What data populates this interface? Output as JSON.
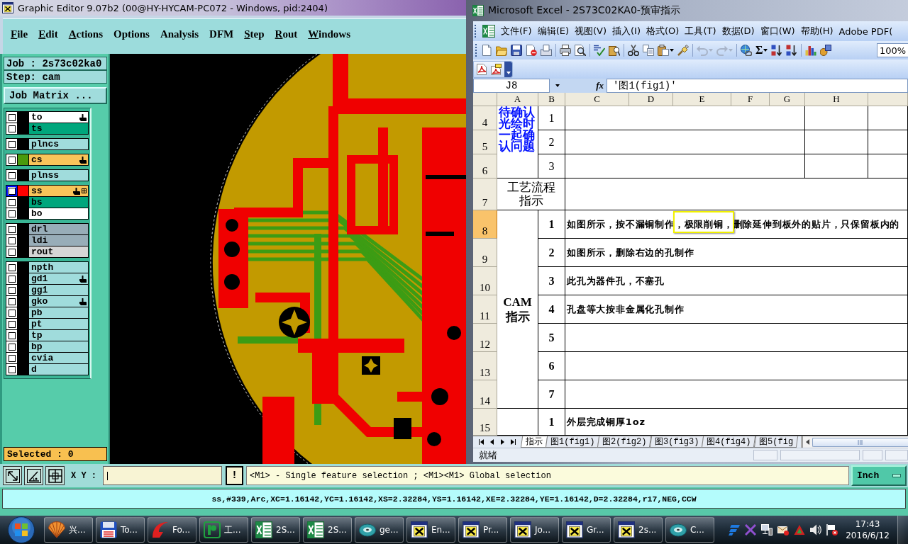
{
  "editor": {
    "title": "Graphic Editor 9.07b2 (00@HY-HYCAM-PC072 - Windows, pid:2404)",
    "menu": [
      {
        "label": "File",
        "mnemonic": true
      },
      {
        "label": "Edit",
        "mnemonic": true
      },
      {
        "label": "Actions",
        "mnemonic": true
      },
      {
        "label": "Options",
        "mnemonic": false
      },
      {
        "label": "Analysis",
        "mnemonic": false
      },
      {
        "label": "DFM",
        "mnemonic": false
      },
      {
        "label": "Step",
        "mnemonic": true
      },
      {
        "label": "Rout",
        "mnemonic": true
      },
      {
        "label": "Windows",
        "mnemonic": true
      }
    ],
    "job": "Job : 2s73c02ka0",
    "step": "Step: cam",
    "job_matrix_button": "Job Matrix ...",
    "layer_groups": [
      {
        "layers": [
          {
            "name": "to",
            "kind": "silk",
            "checked": false,
            "selected": false,
            "hand": true,
            "grid": false
          },
          {
            "name": "ts",
            "kind": "mask",
            "checked": false,
            "selected": false,
            "hand": false,
            "grid": false
          }
        ]
      },
      {
        "layers": [
          {
            "name": "plncs",
            "kind": "document",
            "checked": false,
            "selected": false,
            "hand": false,
            "grid": false
          }
        ]
      },
      {
        "layers": [
          {
            "name": "cs",
            "kind": "signal",
            "color": "#4a9a0c",
            "checked": false,
            "selected": false,
            "hand": true,
            "grid": false
          }
        ]
      },
      {
        "layers": [
          {
            "name": "plnss",
            "kind": "document",
            "checked": false,
            "selected": false,
            "hand": false,
            "grid": false
          }
        ]
      },
      {
        "layers": [
          {
            "name": "ss",
            "kind": "signal",
            "color": "#ff0000",
            "checked": false,
            "selected": true,
            "hand": true,
            "grid": true
          },
          {
            "name": "bs",
            "kind": "mask",
            "checked": false,
            "selected": false,
            "hand": false,
            "grid": false
          },
          {
            "name": "bo",
            "kind": "silk",
            "checked": false,
            "selected": false,
            "hand": false,
            "grid": false
          }
        ]
      },
      {
        "layers": [
          {
            "name": "drl",
            "kind": "drill",
            "checked": false,
            "selected": false,
            "hand": false,
            "grid": false
          },
          {
            "name": "ldi",
            "kind": "drill",
            "checked": false,
            "selected": false,
            "hand": false,
            "grid": false
          },
          {
            "name": "rout",
            "kind": "rout",
            "checked": false,
            "selected": false,
            "hand": false,
            "grid": false
          }
        ]
      },
      {
        "layers": [
          {
            "name": "npth",
            "kind": "document",
            "checked": false,
            "selected": false,
            "hand": false,
            "grid": false
          },
          {
            "name": "gd1",
            "kind": "document",
            "checked": false,
            "selected": false,
            "hand": true,
            "grid": false
          },
          {
            "name": "gg1",
            "kind": "document",
            "checked": false,
            "selected": false,
            "hand": false,
            "grid": false
          },
          {
            "name": "gko",
            "kind": "document",
            "checked": false,
            "selected": false,
            "hand": true,
            "grid": false
          },
          {
            "name": "pb",
            "kind": "document",
            "checked": false,
            "selected": false,
            "hand": false,
            "grid": false
          },
          {
            "name": "pt",
            "kind": "document",
            "checked": false,
            "selected": false,
            "hand": false,
            "grid": false
          },
          {
            "name": "tp",
            "kind": "document",
            "checked": false,
            "selected": false,
            "hand": false,
            "grid": false
          },
          {
            "name": "bp",
            "kind": "document",
            "checked": false,
            "selected": false,
            "hand": false,
            "grid": false
          },
          {
            "name": "cvia",
            "kind": "document",
            "checked": false,
            "selected": false,
            "hand": false,
            "grid": false
          },
          {
            "name": "d",
            "kind": "document",
            "checked": false,
            "selected": false,
            "hand": false,
            "grid": false
          }
        ]
      }
    ],
    "selected_count": "Selected : 0",
    "xy_label": "X Y :",
    "xy_field": {
      "focused": true
    },
    "alert_button": "!",
    "message": "<M1> - Single feature selection ; <M1><M1> Global selection",
    "units_button": "Inch",
    "status_line": "ss,#339,Arc,XC=1.16142,YC=1.16142,XS=2.32284,YS=1.16142,XE=2.32284,YE=1.16142,D=2.32284,r17,NEG,CCW"
  },
  "excel": {
    "title": "Microsoft Excel - 2S73C02KA0-预审指示",
    "menu": [
      "文件(F)",
      "编辑(E)",
      "视图(V)",
      "插入(I)",
      "格式(O)",
      "工具(T)",
      "数据(D)",
      "窗口(W)",
      "帮助(H)",
      "Adobe PDF("
    ],
    "undo": {
      "disabled": true
    },
    "redo": {
      "disabled": true
    },
    "autosum": "Σ",
    "zoom": "100%",
    "name_box": "J8",
    "function_button": "fx",
    "formula": "'图1(fig1)'",
    "columns": [
      "A",
      "B",
      "C",
      "D",
      "E",
      "F",
      "G",
      "H"
    ],
    "row_headers": [
      {
        "label": "4",
        "selected": false
      },
      {
        "label": "5",
        "selected": false
      },
      {
        "label": "6",
        "selected": false
      },
      {
        "label": "7",
        "selected": false
      },
      {
        "label": "8",
        "selected": true
      },
      {
        "label": "9",
        "selected": false
      },
      {
        "label": "10",
        "selected": false
      },
      {
        "label": "11",
        "selected": false
      },
      {
        "label": "12",
        "selected": false
      },
      {
        "label": "13",
        "selected": false
      },
      {
        "label": "14",
        "selected": false
      },
      {
        "label": "15",
        "selected": false
      }
    ],
    "sections": [
      {
        "kind": "question",
        "title": "待确认光绘时一起确认问题",
        "items": [
          {
            "number": "1"
          },
          {
            "number": "2"
          },
          {
            "number": "3"
          }
        ]
      },
      {
        "kind": "process",
        "title": "工艺流程指示"
      },
      {
        "kind": "cam",
        "title": "CAM指示",
        "items": [
          {
            "number": "1",
            "text": "如图所示，按不漏铜制作，极限削铜，删除延伸到板外的贴片，只保留板内的",
            "outlined": true
          },
          {
            "number": "2",
            "text": "如图所示，删除右边的孔制作",
            "outlined": false
          },
          {
            "number": "3",
            "text": "此孔为器件孔，不塞孔",
            "outlined": false
          },
          {
            "number": "4",
            "text": "孔盘等大按非金属化孔制作",
            "outlined": false
          },
          {
            "number": "5",
            "outlined": false
          },
          {
            "number": "6",
            "outlined": false
          },
          {
            "number": "7",
            "outlined": false
          }
        ]
      },
      {
        "kind": "plain",
        "items": [
          {
            "number": "1",
            "text": "外层完成铜厚1oz",
            "outlined": false
          }
        ]
      }
    ],
    "sheet_tabs": [
      {
        "label": "指示",
        "selected": true
      },
      {
        "label": "图1(fig1)",
        "selected": false
      },
      {
        "label": "图2(fig2)",
        "selected": false
      },
      {
        "label": "图3(fig3)",
        "selected": false
      },
      {
        "label": "图4(fig4)",
        "selected": false
      },
      {
        "label": "图5(fig",
        "selected": false
      }
    ],
    "status": "就绪"
  },
  "taskbar": {
    "buttons": [
      {
        "label": "兴...",
        "kind": "shell"
      },
      {
        "label": "To...",
        "kind": "floppy"
      },
      {
        "label": "Fo...",
        "kind": "swoosh"
      },
      {
        "label": "工...",
        "kind": "logo"
      },
      {
        "label": "2S...",
        "kind": "spreadsheet"
      },
      {
        "label": "2S...",
        "kind": "spreadsheet"
      },
      {
        "label": "ge...",
        "kind": "disc"
      },
      {
        "label": "En...",
        "kind": "window"
      },
      {
        "label": "Pr...",
        "kind": "window"
      },
      {
        "label": "Jo...",
        "kind": "window"
      },
      {
        "label": "Gr...",
        "kind": "window"
      },
      {
        "label": "2s...",
        "kind": "window"
      },
      {
        "label": "C...",
        "kind": "disc"
      }
    ],
    "time": "17:43",
    "date": "2016/6/12"
  }
}
